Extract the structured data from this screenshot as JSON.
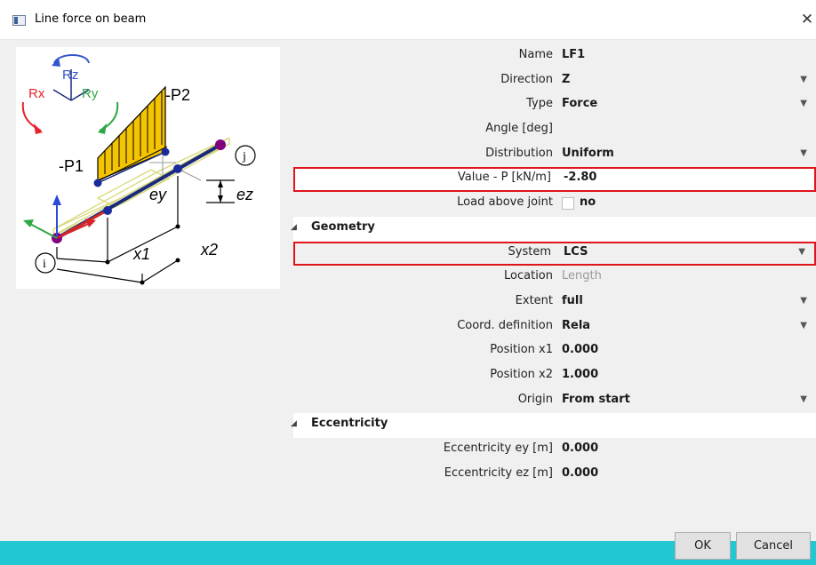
{
  "window": {
    "title": "Line force on beam",
    "close_glyph": "✕"
  },
  "diagram": {
    "labels": {
      "rz": "Rz",
      "rx": "Rx",
      "ry": "Ry",
      "p1": "-P1",
      "p2": "-P2",
      "ey": "ey",
      "ez": "ez",
      "x1": "x1",
      "x2": "x2",
      "i": "i",
      "j": "j"
    },
    "colors": {
      "load_fill": "#f5c400",
      "beam": "#1a2a7a",
      "node": "#800080",
      "rx": "#e8232a",
      "ry": "#2da844",
      "rz": "#3355cc",
      "lcs_outline": "#d8d87a"
    }
  },
  "properties": {
    "name": {
      "label": "Name",
      "value": "LF1"
    },
    "direction": {
      "label": "Direction",
      "value": "Z"
    },
    "type": {
      "label": "Type",
      "value": "Force"
    },
    "angle": {
      "label": "Angle [deg]",
      "value": ""
    },
    "distribution": {
      "label": "Distribution",
      "value": "Uniform"
    },
    "value_p": {
      "label": "Value - P [kN/m]",
      "value": "-2.80"
    },
    "load_above_joint": {
      "label": "Load above joint",
      "value": "no"
    },
    "geometry": {
      "title": "Geometry",
      "system": {
        "label": "System",
        "value": "LCS"
      },
      "location": {
        "label": "Location",
        "value": "Length"
      },
      "extent": {
        "label": "Extent",
        "value": "full"
      },
      "coord_definition": {
        "label": "Coord. definition",
        "value": "Rela"
      },
      "position_x1": {
        "label": "Position x1",
        "value": "0.000"
      },
      "position_x2": {
        "label": "Position x2",
        "value": "1.000"
      },
      "origin": {
        "label": "Origin",
        "value": "From start"
      }
    },
    "eccentricity": {
      "title": "Eccentricity",
      "ey": {
        "label": "Eccentricity ey [m]",
        "value": "0.000"
      },
      "ez": {
        "label": "Eccentricity ez [m]",
        "value": "0.000"
      }
    }
  },
  "buttons": {
    "ok": "OK",
    "cancel": "Cancel"
  },
  "colors": {
    "accent_bar": "#22c7d4",
    "highlight_border": "#e0141b"
  }
}
